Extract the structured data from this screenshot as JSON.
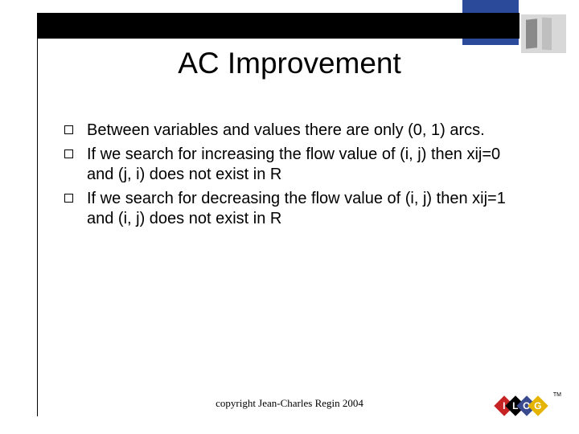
{
  "title": "AC Improvement",
  "bullets": {
    "item0": "Between variables and values there are only (0, 1) arcs.",
    "item1": "If we search for increasing the flow value of (i, j) then xij=0 and (j, i) does not exist in R",
    "item2": "If we search for decreasing the flow value of (i, j) then xij=1 and (i, j) does not exist in R"
  },
  "footer": "copyright Jean-Charles Regin 2004",
  "logo": {
    "l1": "I",
    "l2": "L",
    "l3": "O",
    "l4": "G",
    "tm": "TM"
  }
}
